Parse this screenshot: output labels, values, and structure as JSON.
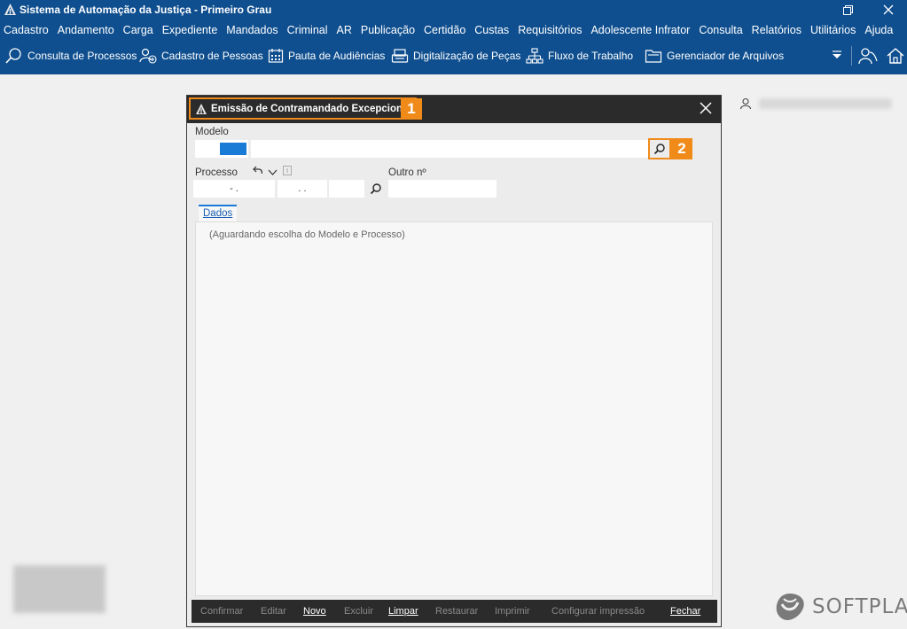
{
  "app": {
    "title": "Sistema de Automação da Justiça - Primeiro Grau"
  },
  "menu": {
    "items": [
      "Cadastro",
      "Andamento",
      "Carga",
      "Expediente",
      "Mandados",
      "Criminal",
      "AR",
      "Publicação",
      "Certidão",
      "Custas",
      "Requisitórios",
      "Adolescente Infrator",
      "Consulta",
      "Relatórios",
      "Utilitários",
      "Ajuda"
    ]
  },
  "toolbar": {
    "consulta": "Consulta de Processos",
    "cadastro_pessoas": "Cadastro de Pessoas",
    "pauta": "Pauta de Audiências",
    "digitalizacao": "Digitalização de Peças",
    "fluxo": "Fluxo de Trabalho",
    "gerenciador": "Gerenciador de Arquivos"
  },
  "dialog": {
    "title": "Emissão de Contramandado Excepcional",
    "callout_1": "1",
    "callout_2": "2",
    "modelo_label": "Modelo",
    "processo_label": "Processo",
    "outro_label": "Outro nº",
    "processo_mask_1": "-   .",
    "processo_mask_2": ".   .",
    "tab_dados": "Dados",
    "waiting_message": "(Aguardando escolha do Modelo e Processo)"
  },
  "footer": {
    "confirmar": "Confirmar",
    "editar": "Editar",
    "novo": "Novo",
    "excluir": "Excluir",
    "limpar": "Limpar",
    "restaurar": "Restaurar",
    "imprimir": "Imprimir",
    "configurar": "Configurar impressão",
    "fechar": "Fechar"
  },
  "brand": {
    "name": "SOFTPLAN"
  },
  "colors": {
    "header_blue": "#0f4f8f",
    "accent_orange": "#f08b1a",
    "dialog_dark": "#2b2b2b",
    "selection_blue": "#1a7bd6"
  }
}
